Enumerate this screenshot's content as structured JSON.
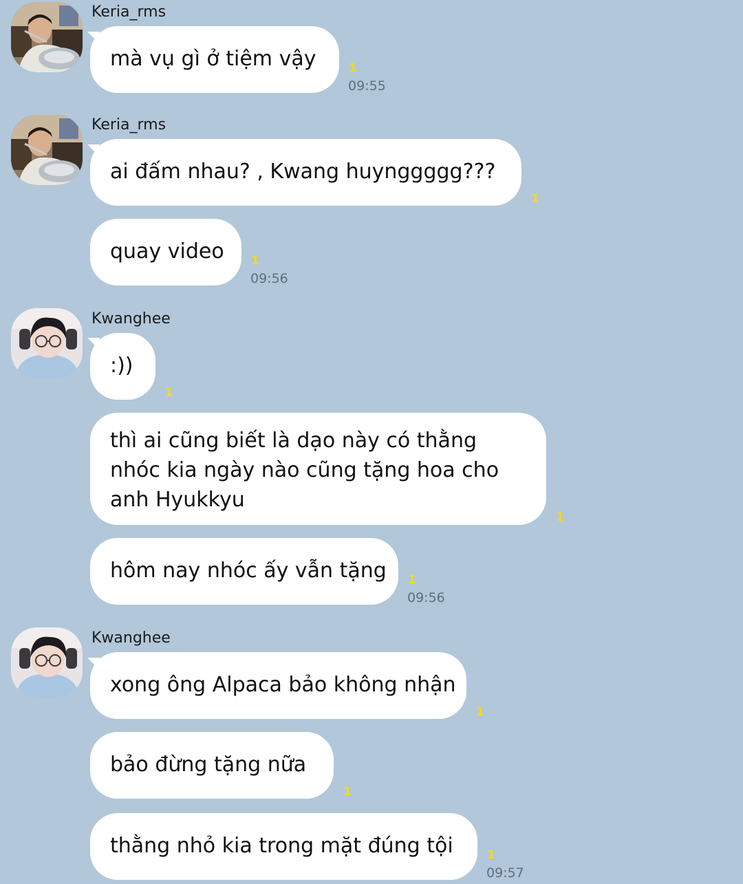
{
  "users": {
    "keria": "Keria_rms",
    "kwanghee": "Kwanghee"
  },
  "messages": [
    {
      "sender": "Keria_rms",
      "text": "mà vụ gì ở tiệm vậy",
      "unread": "1",
      "time": "09:55"
    },
    {
      "sender": "Keria_rms",
      "text": "ai đấm nhau? , Kwang huynggggg???",
      "unread": "1"
    },
    {
      "text": "quay video",
      "unread": "1",
      "time": "09:56"
    },
    {
      "sender": "Kwanghee",
      "text": ":))",
      "unread": "1"
    },
    {
      "lines": [
        "thì ai cũng biết là dạo này có thằng",
        "nhóc kia ngày nào cũng tặng hoa cho",
        "anh Hyukkyu"
      ],
      "unread": "1"
    },
    {
      "text": "hôm nay nhóc ấy vẫn tặng",
      "unread": "1",
      "time": "09:56"
    },
    {
      "sender": "Kwanghee",
      "text": "xong ông Alpaca bảo không nhận",
      "unread": "1"
    },
    {
      "text": "bảo đừng tặng nữa",
      "unread": "1"
    },
    {
      "text": "thằng nhỏ kia trong mặt đúng tội",
      "unread": "1",
      "time": "09:57"
    }
  ],
  "icons": {
    "avatar_keria": "avatar-keria-icon",
    "avatar_kwanghee": "avatar-kwanghee-icon"
  },
  "colors": {
    "background": "#b2c7d9",
    "bubble": "#ffffff",
    "unread": "#f5da13",
    "time": "#5f6e7c"
  }
}
